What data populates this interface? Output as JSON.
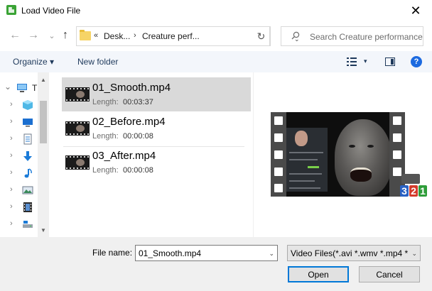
{
  "window": {
    "title": "Load Video File",
    "close_glyph": "✕"
  },
  "nav": {
    "back_glyph": "←",
    "forward_glyph": "→",
    "recent_glyph": "⌄",
    "up_glyph": "↑",
    "breadcrumb_overflow": "«",
    "breadcrumbs": [
      "Desk...",
      "Creature perf..."
    ],
    "breadcrumb_sep": "›",
    "refresh_glyph": "↻",
    "dropdown_glyph": "⌄"
  },
  "search": {
    "placeholder": "Search Creature performance"
  },
  "toolbar": {
    "organize_label": "Organize ▾",
    "new_folder_label": "New folder",
    "view_dropdown_glyph": "▾",
    "help_glyph": "?"
  },
  "navpane": {
    "items": [
      {
        "label": "T",
        "icon": "this-pc-icon",
        "expanded": true
      },
      {
        "label": "",
        "icon": "3d-objects-icon"
      },
      {
        "label": "",
        "icon": "desktop-icon"
      },
      {
        "label": "",
        "icon": "documents-icon"
      },
      {
        "label": "",
        "icon": "downloads-icon"
      },
      {
        "label": "",
        "icon": "music-icon"
      },
      {
        "label": "",
        "icon": "pictures-icon"
      },
      {
        "label": "",
        "icon": "videos-icon"
      },
      {
        "label": "",
        "icon": "local-disk-icon"
      }
    ],
    "scroll_up": "▲",
    "scroll_down": "▼"
  },
  "files": [
    {
      "name": "01_Smooth.mp4",
      "length_label": "Length:",
      "length": "00:03:37",
      "selected": true
    },
    {
      "name": "02_Before.mp4",
      "length_label": "Length:",
      "length": "00:00:08",
      "selected": false
    },
    {
      "name": "03_After.mp4",
      "length_label": "Length:",
      "length": "00:00:08",
      "selected": false
    }
  ],
  "preview": {
    "logo_digits": [
      "3",
      "2",
      "1"
    ],
    "logo_colors": [
      "#2a62c4",
      "#d43a2b",
      "#2f9d3a"
    ]
  },
  "footer": {
    "filename_label": "File name:",
    "filename_value": "01_Smooth.mp4",
    "filter_value": "Video Files(*.avi *.wmv *.mp4 *",
    "dropdown_glyph": "⌄",
    "open_label": "Open",
    "cancel_label": "Cancel"
  },
  "colors": {
    "accent": "#0078d7",
    "selection": "#d9d9d9",
    "toolbar_bg": "#f3f6fb",
    "footer_bg": "#f0f0f0"
  }
}
